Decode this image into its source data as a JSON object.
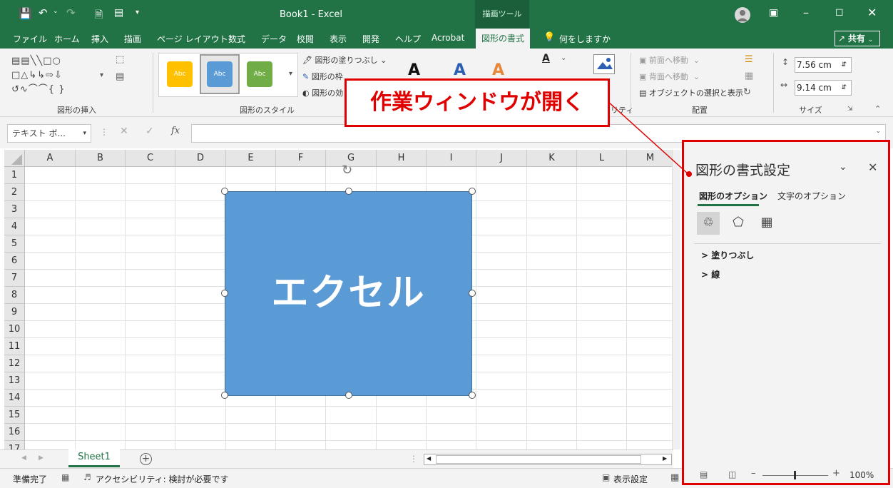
{
  "window": {
    "qat_buttons": [
      "save",
      "undo",
      "redo",
      "new",
      "form",
      "more"
    ],
    "title": "Book1  -  Excel",
    "context_tab_group": "描画ツール",
    "share_label": "共有"
  },
  "tabs": [
    {
      "label": "ファイル"
    },
    {
      "label": "ホーム"
    },
    {
      "label": "挿入"
    },
    {
      "label": "描画"
    },
    {
      "label": "ページ レイアウト"
    },
    {
      "label": "数式"
    },
    {
      "label": "データ"
    },
    {
      "label": "校閲"
    },
    {
      "label": "表示"
    },
    {
      "label": "開発"
    },
    {
      "label": "ヘルプ"
    },
    {
      "label": "Acrobat"
    },
    {
      "label": "図形の書式",
      "active": true
    }
  ],
  "tell_me": "何をしますか",
  "ribbon": {
    "groups": {
      "insert_shapes": "図形の挿入",
      "shape_styles": "図形のスタイル",
      "arrange": "配置",
      "size": "サイズ",
      "accessibility_partial": "リティ"
    },
    "shape_style_samples": [
      "Abc",
      "Abc",
      "Abc"
    ],
    "fill_label": "図形の塗りつぶし",
    "outline_label": "図形の枠",
    "effects_label": "図形の効",
    "bring_forward": "前面へ移動",
    "send_backward": "背面へ移動",
    "selection_pane": "オブジェクトの選択と表示",
    "height": "7.56 cm",
    "width": "9.14 cm"
  },
  "formula_bar": {
    "name_box": "テキスト ボ...",
    "fx": "fx"
  },
  "grid": {
    "columns": [
      "A",
      "B",
      "C",
      "D",
      "E",
      "F",
      "G",
      "H",
      "I",
      "J",
      "K",
      "L",
      "M"
    ],
    "rows": [
      "1",
      "2",
      "3",
      "4",
      "5",
      "6",
      "7",
      "8",
      "9",
      "10",
      "11",
      "12",
      "13",
      "14",
      "15",
      "16",
      "17"
    ]
  },
  "shape": {
    "text": "エクセル",
    "fill_color": "#5b9bd5"
  },
  "callout": {
    "text": "作業ウィンドウが開く",
    "color": "#e00000"
  },
  "pane": {
    "title": "図形の書式設定",
    "tabs": [
      "図形のオプション",
      "文字のオプション"
    ],
    "sections": [
      "塗りつぶし",
      "線"
    ]
  },
  "sheets": {
    "tabs": [
      "Sheet1"
    ]
  },
  "status": {
    "ready": "準備完了",
    "accessibility": "アクセシビリティ: 検討が必要です",
    "display_settings": "表示設定",
    "zoom": "100%"
  },
  "colors": {
    "excel_green": "#217346",
    "accent_blue": "#5b9bd5",
    "highlight_red": "#e00000"
  }
}
